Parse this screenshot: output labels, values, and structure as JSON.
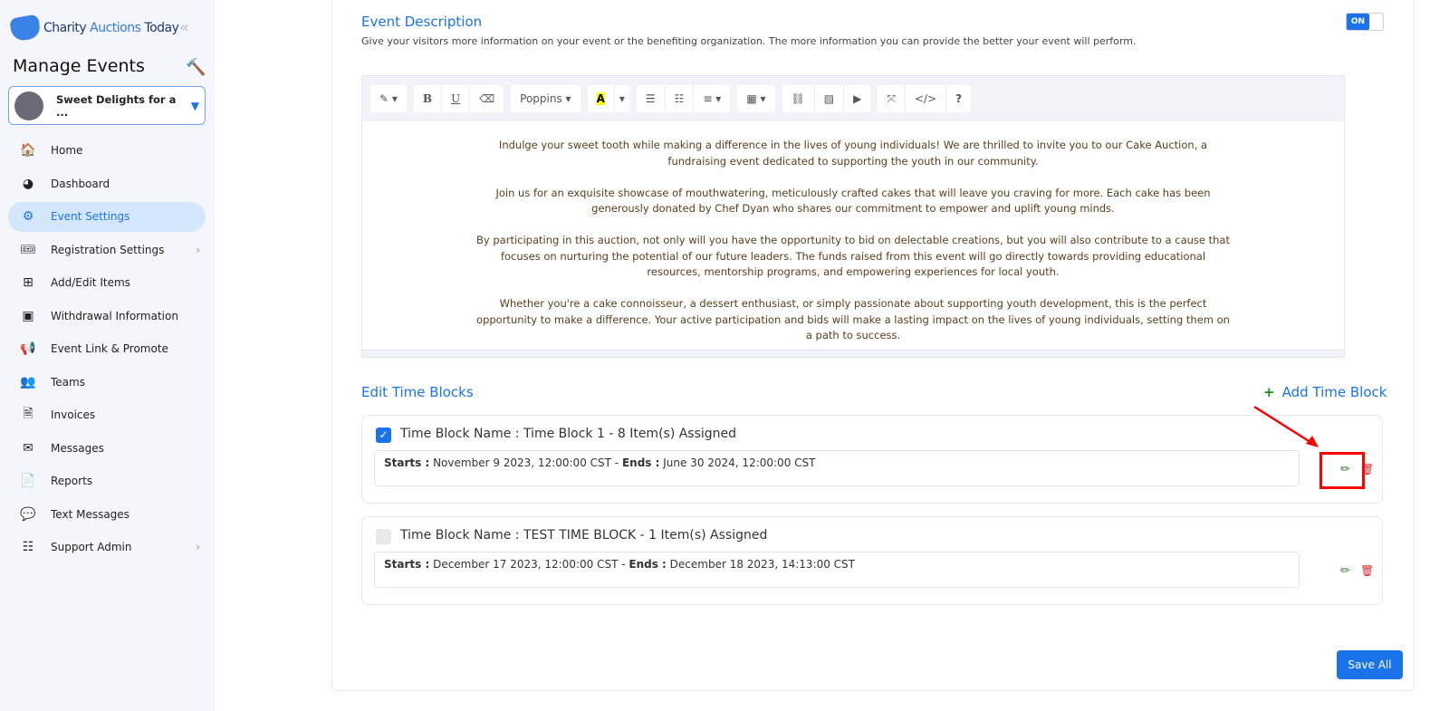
{
  "sidebar": {
    "logo": {
      "part1": "Charity",
      "part2": "Auctions",
      "part3": "Today"
    },
    "title": "Manage Events",
    "event": "Sweet Delights for a ...",
    "items": [
      {
        "label": "Home",
        "icon": "🏠"
      },
      {
        "label": "Dashboard",
        "icon": "◕"
      },
      {
        "label": "Event Settings",
        "icon": "⚙",
        "active": true
      },
      {
        "label": "Registration Settings",
        "icon": "🎟",
        "chev": true
      },
      {
        "label": "Add/Edit Items",
        "icon": "⊞"
      },
      {
        "label": "Withdrawal Information",
        "icon": "▣"
      },
      {
        "label": "Event Link & Promote",
        "icon": "📢"
      },
      {
        "label": "Teams",
        "icon": "👥"
      },
      {
        "label": "Invoices",
        "icon": "🗎"
      },
      {
        "label": "Messages",
        "icon": "✉"
      },
      {
        "label": "Reports",
        "icon": "📄"
      },
      {
        "label": "Text Messages",
        "icon": "💬"
      },
      {
        "label": "Support Admin",
        "icon": "☷",
        "chev": true
      }
    ]
  },
  "main": {
    "desc_title": "Event Description",
    "desc_text": "Give your visitors more information on your event or the benefiting organization.  The more information you can provide the better your event will perform.",
    "toggle": "ON",
    "toolbar": {
      "font": "Poppins"
    },
    "content": [
      "Indulge your sweet tooth while making a difference in the lives of young individuals! We are thrilled to invite you to our Cake Auction, a fundraising event dedicated to supporting the youth in our community.",
      "Join us for an exquisite showcase of mouthwatering, meticulously crafted cakes that will leave you craving for more. Each cake has been generously donated by Chef Dyan who shares our commitment to empower and uplift young minds.",
      "By participating in this auction, not only will you have the opportunity to bid on delectable creations, but you will also contribute to a cause that focuses on nurturing the potential of our future leaders. The funds raised from this event will go directly towards providing educational resources, mentorship programs, and empowering experiences for local youth.",
      "Whether you're a cake connoisseur, a dessert enthusiast, or simply passionate about supporting youth development, this is the perfect opportunity to make a difference. Your active participation and bids will make a lasting impact on the lives of young individuals, setting them on a path to success."
    ],
    "tb_title": "Edit Time Blocks",
    "add_label": "Add Time Block",
    "blocks": [
      {
        "name_label": "Time Block Name :",
        "name": "Time Block 1 - 8 Item(s) Assigned",
        "starts_label": "Starts :",
        "starts": "November 9 2023, 12:00:00 CST -",
        "ends_label": "Ends :",
        "ends": "June 30 2024, 12:00:00 CST",
        "checked": true
      },
      {
        "name_label": "Time Block Name :",
        "name": "TEST TIME BLOCK - 1 Item(s) Assigned",
        "starts_label": "Starts :",
        "starts": "December 17 2023, 12:00:00 CST -",
        "ends_label": "Ends :",
        "ends": "December 18 2023, 14:13:00 CST",
        "checked": false
      }
    ],
    "save": "Save All"
  }
}
